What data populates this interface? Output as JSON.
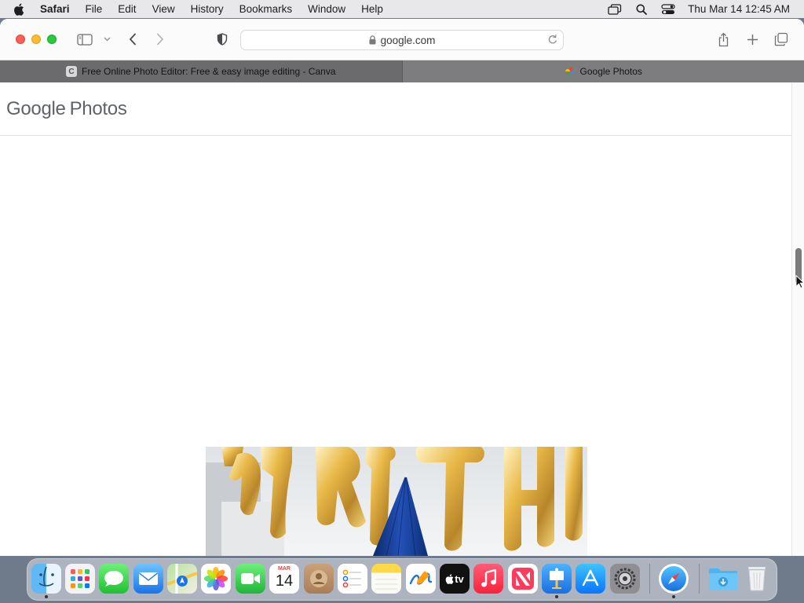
{
  "menubar": {
    "app_name": "Safari",
    "items": [
      "File",
      "Edit",
      "View",
      "History",
      "Bookmarks",
      "Window",
      "Help"
    ],
    "clock": "Thu Mar 14  12:45 AM",
    "status_icons": [
      "screen-mirroring-icon",
      "spotlight-search-icon",
      "control-center-icon"
    ]
  },
  "toolbar": {
    "url": "google.com"
  },
  "tabs": [
    {
      "label": "Free Online Photo Editor: Free & easy image editing - Canva",
      "favicon_letter": "C",
      "active": false
    },
    {
      "label": "Google Photos",
      "active": true
    }
  ],
  "page": {
    "logo_google": "Google",
    "logo_photos": "Photos"
  },
  "dock": {
    "calendar_month": "MAR",
    "calendar_day": "14",
    "tv_label": "tv",
    "apps": [
      "Finder",
      "Launchpad",
      "Messages",
      "Mail",
      "Maps",
      "Photos",
      "FaceTime",
      "Calendar",
      "Contacts",
      "Reminders",
      "Notes",
      "Freeform",
      "TV",
      "Music",
      "News",
      "Keynote",
      "App Store",
      "System Settings",
      "Safari",
      "Downloads",
      "Trash"
    ]
  },
  "colors": {
    "accent": "#007aff",
    "close": "#ff5f57",
    "minimize": "#febc2e",
    "maximize": "#28c840"
  }
}
